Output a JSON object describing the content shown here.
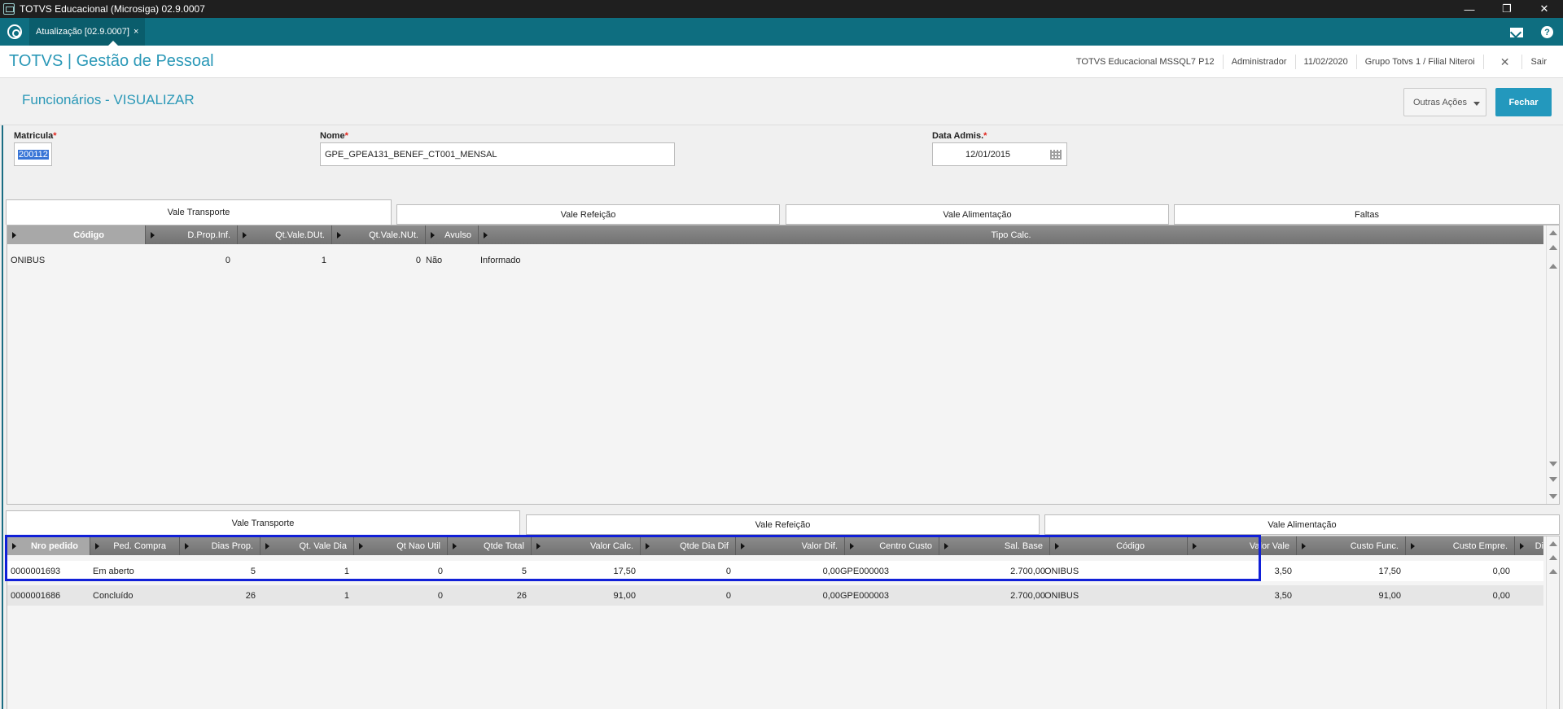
{
  "window": {
    "title": "TOTVS Educacional (Microsiga) 02.9.0007",
    "minimize": "—",
    "restore": "❐",
    "close": "✕"
  },
  "tabbar": {
    "tab_label": "Atualização [02.9.0007]",
    "tab_close": "×"
  },
  "header": {
    "brand": "TOTVS | Gestão de Pessoal",
    "environment": "TOTVS Educacional MSSQL7 P12",
    "user": "Administrador",
    "date": "11/02/2020",
    "company": "Grupo Totvs 1 / Filial Niteroi",
    "sair": "Sair",
    "sair_icon": "✕"
  },
  "page": {
    "title": "Funcionários - VISUALIZAR",
    "outras_acoes": "Outras Ações",
    "fechar": "Fechar"
  },
  "form": {
    "matricula_label": "Matricula",
    "matricula_value": "200112",
    "nome_label": "Nome",
    "nome_value": "GPE_GPEA131_BENEF_CT001_MENSAL",
    "data_label": "Data Admis.",
    "data_value": "12/01/2015",
    "required_mark": "*"
  },
  "top_tabs": [
    "Vale Transporte",
    "Vale Refeição",
    "Vale Alimentação",
    "Faltas"
  ],
  "top_grid": {
    "columns": [
      "Código",
      "D.Prop.Inf.",
      "Qt.Vale.DUt.",
      "Qt.Vale.NUt.",
      "Avulso",
      "Tipo Calc."
    ],
    "rows": [
      [
        "ONIBUS",
        "0",
        "1",
        "0",
        "Não",
        "Informado"
      ]
    ]
  },
  "bottom_tabs": [
    "Vale Transporte",
    "Vale Refeição",
    "Vale Alimentação"
  ],
  "bottom_grid": {
    "columns": [
      "Nro pedido",
      "Ped. Compra",
      "Dias Prop.",
      "Qt. Vale Dia",
      "Qt Nao Util",
      "Qtde Total",
      "Valor Calc.",
      "Qtde Dia Dif",
      "Valor Dif.",
      "Centro Custo",
      "Sal. Base",
      "Código",
      "Valor Vale",
      "Custo Func.",
      "Custo Empre.",
      "Di"
    ],
    "rows": [
      [
        "0000001693",
        "Em aberto",
        "5",
        "1",
        "0",
        "5",
        "17,50",
        "0",
        "0,00",
        "GPE000003",
        "2.700,00",
        "ONIBUS",
        "3,50",
        "17,50",
        "0,00"
      ],
      [
        "0000001686",
        "Concluído",
        "26",
        "1",
        "0",
        "26",
        "91,00",
        "0",
        "0,00",
        "GPE000003",
        "2.700,00",
        "ONIBUS",
        "3,50",
        "91,00",
        "0,00"
      ]
    ]
  },
  "colors": {
    "teal": "#0e6e80",
    "brand": "#2a98b7",
    "button": "#2398bd",
    "highlight": "#1120d8"
  }
}
